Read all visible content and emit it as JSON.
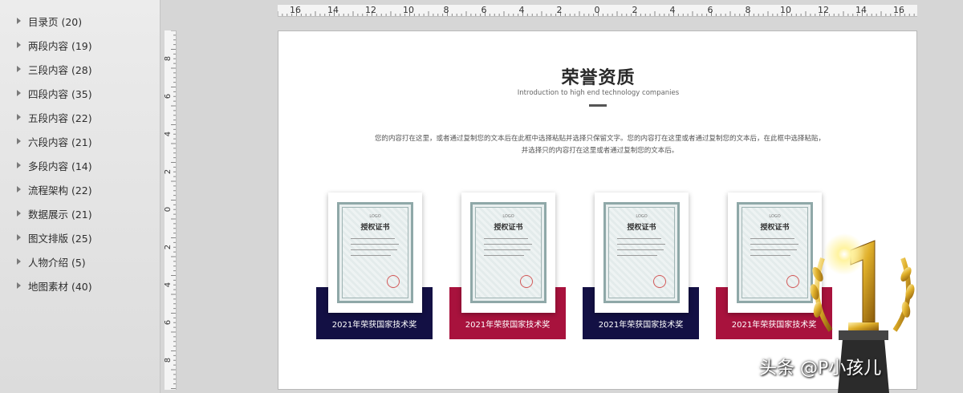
{
  "sidebar": {
    "items": [
      {
        "label": "目录页 (20)"
      },
      {
        "label": "两段内容 (19)"
      },
      {
        "label": "三段内容 (28)"
      },
      {
        "label": "四段内容 (35)"
      },
      {
        "label": "五段内容 (22)"
      },
      {
        "label": "六段内容 (21)"
      },
      {
        "label": "多段内容 (14)"
      },
      {
        "label": "流程架构 (22)"
      },
      {
        "label": "数据展示 (21)"
      },
      {
        "label": "图文排版 (25)"
      },
      {
        "label": "人物介绍 (5)"
      },
      {
        "label": "地图素材 (40)"
      }
    ]
  },
  "ruler": {
    "h_labels": [
      "16",
      "14",
      "12",
      "10",
      "8",
      "6",
      "4",
      "2",
      "0",
      "2",
      "4",
      "6",
      "8",
      "10",
      "12",
      "14",
      "16"
    ],
    "v_labels": [
      "8",
      "6",
      "4",
      "2",
      "0",
      "2",
      "4",
      "6",
      "8"
    ]
  },
  "slide": {
    "title": "荣誉资质",
    "subtitle": "Introduction to high end technology companies",
    "body": "您的内容打在这里，或者通过复制您的文本后在此框中选择粘贴并选择只保留文字。您的内容打在这里或者通过复制您的文本后，在此框中选择粘贴，并选择只的内容打在这里或者通过复制您的文本后。",
    "cards": [
      {
        "caption": "2021年荣获国家技术奖",
        "band_color": "#131044",
        "cert_logo": "LOGO",
        "cert_title": "授权证书"
      },
      {
        "caption": "2021年荣获国家技术奖",
        "band_color": "#a8123d",
        "cert_logo": "LOGO",
        "cert_title": "授权证书"
      },
      {
        "caption": "2021年荣获国家技术奖",
        "band_color": "#131044",
        "cert_logo": "LOGO",
        "cert_title": "授权证书"
      },
      {
        "caption": "2021年荣获国家技术奖",
        "band_color": "#a8123d",
        "cert_logo": "LOGO",
        "cert_title": "授权证书"
      }
    ]
  },
  "watermark": "头条 @P小孩儿",
  "colors": {
    "navy": "#131044",
    "crimson": "#a8123d",
    "gold": "#d9a520"
  }
}
